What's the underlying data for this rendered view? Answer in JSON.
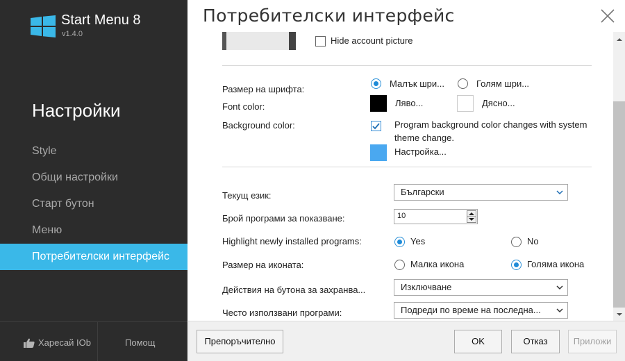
{
  "app": {
    "name": "Start Menu 8",
    "version": "v1.4.0",
    "logo_icon": "windows-logo-icon",
    "accent_color": "#3ab8e8"
  },
  "sidebar": {
    "heading": "Настройки",
    "items": [
      {
        "label": "Style",
        "active": false
      },
      {
        "label": "Общи настройки",
        "active": false
      },
      {
        "label": "Старт бутон",
        "active": false
      },
      {
        "label": "Меню",
        "active": false
      },
      {
        "label": "Потребителски интерфейс",
        "active": true
      }
    ],
    "footer": {
      "like_label": "Харесай IOb",
      "like_icon": "thumbs-up-icon",
      "help_label": "Помощ"
    }
  },
  "main": {
    "title": "Потребителски интерфейс",
    "close_icon": "close-icon",
    "account": {
      "hide_picture_label": "Hide account picture",
      "hide_picture_checked": false
    },
    "font": {
      "size_label": "Размер на шрифта:",
      "size_options": [
        {
          "label": "Малък шри...",
          "selected": true
        },
        {
          "label": "Голям шри...",
          "selected": false
        }
      ],
      "color_label": "Font color:",
      "color_left_label": "Ляво...",
      "color_left_value": "#000000",
      "color_right_label": "Дясно...",
      "color_right_value": "#ffffff"
    },
    "background": {
      "label": "Background color:",
      "sync_label": "Program background color changes with system theme change.",
      "sync_checked": true,
      "custom_label": "Настройка...",
      "custom_color": "#4aa8f0"
    },
    "language": {
      "label": "Текущ език:",
      "value": "Български"
    },
    "program_count": {
      "label": "Брой програми за показване:",
      "value": "10"
    },
    "highlight": {
      "label": "Highlight newly installed programs:",
      "options": [
        {
          "label": "Yes",
          "selected": true
        },
        {
          "label": "No",
          "selected": false
        }
      ]
    },
    "icon_size": {
      "label": "Размер на иконата:",
      "options": [
        {
          "label": "Малка икона",
          "selected": false
        },
        {
          "label": "Голяма икона",
          "selected": true
        }
      ]
    },
    "power_button": {
      "label": "Действия на бутона за захранва...",
      "value": "Изключване"
    },
    "frequent": {
      "label": "Често използвани програми:",
      "value": "Подреди по време на последна..."
    }
  },
  "footer_buttons": {
    "recommended": "Препоръчително",
    "ok": "OK",
    "cancel": "Отказ",
    "apply": "Приложи"
  }
}
